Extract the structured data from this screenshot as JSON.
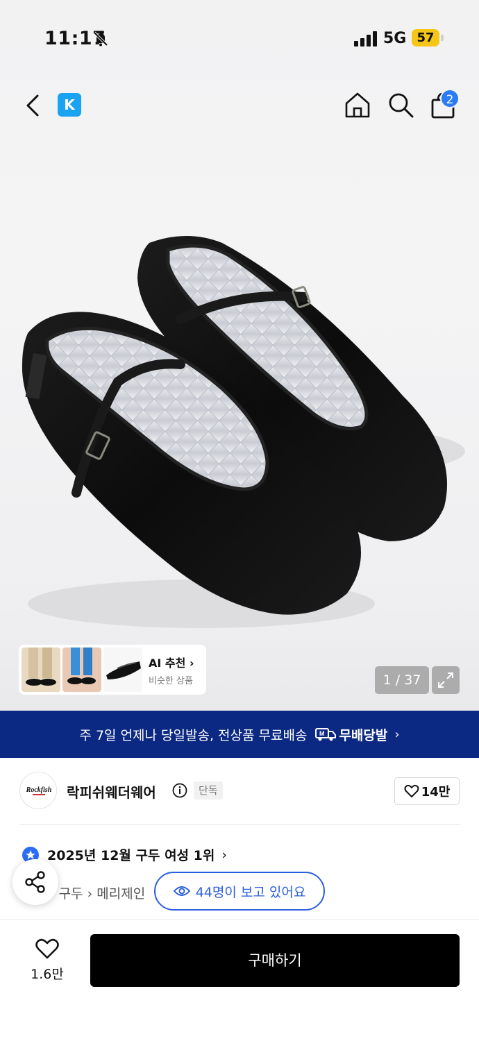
{
  "status_bar": {
    "time": "11:17",
    "network": "5G",
    "battery": "57"
  },
  "nav": {
    "logo": "K",
    "cart_count": "2"
  },
  "ai_recommend": {
    "title": "AI 추천",
    "subtitle": "비슷한 상품"
  },
  "gallery": {
    "counter": "1 / 37"
  },
  "promo": {
    "text": "주 7일 언제나 당일발송, 전상품 무료배송",
    "brand": "무배당발"
  },
  "seller": {
    "name": "락피쉬웨더웨어",
    "tag": "단독",
    "likes": "14만",
    "avatar_text": "Rockfish"
  },
  "ranking": {
    "text": "2025년 12월 구두 여성 1위"
  },
  "breadcrumb": {
    "text": "신발 › 구두 › 메리제인"
  },
  "viewers": {
    "text": "44명이 보고 있어요"
  },
  "bottom": {
    "wish_count": "1.6만",
    "buy_label": "구매하기"
  },
  "colors": {
    "accent_blue": "#2b5fe0",
    "promo_bg": "#0b2883",
    "battery": "#f5c518"
  }
}
